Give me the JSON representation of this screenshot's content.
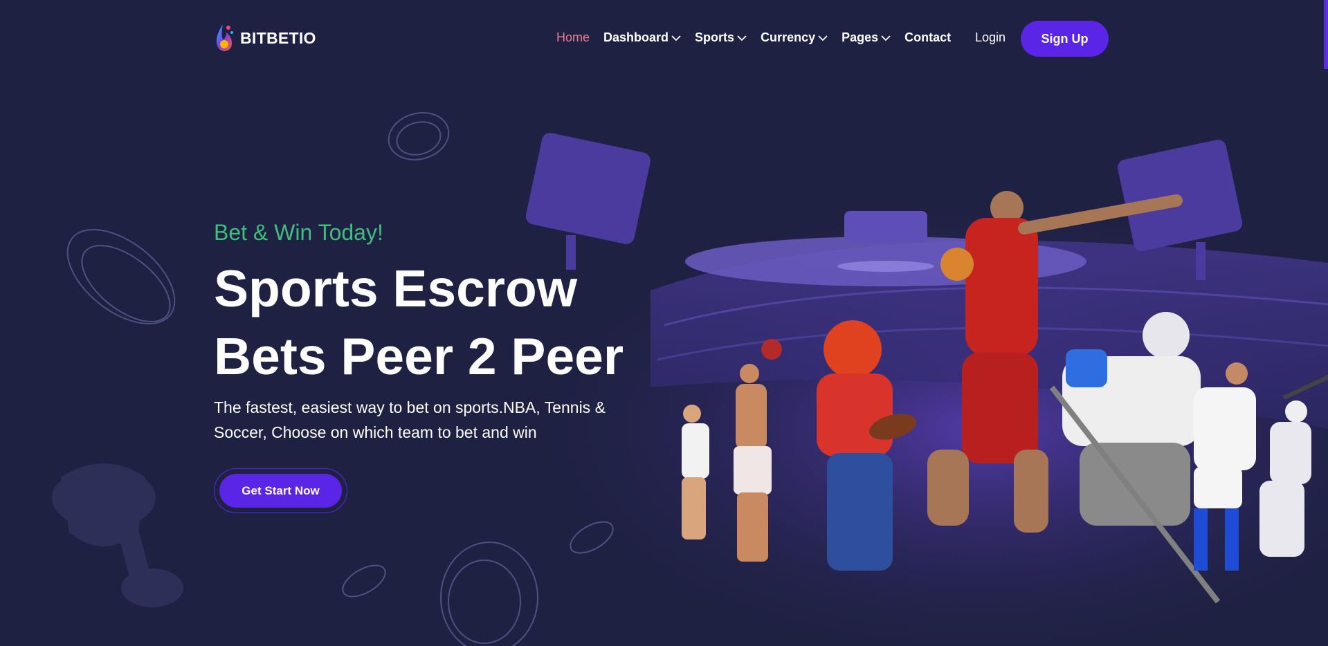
{
  "brand": {
    "name": "BITBETIO",
    "logo_icon": "flame-droplet-icon"
  },
  "nav": {
    "items": [
      {
        "label": "Home",
        "active": true,
        "dropdown": false
      },
      {
        "label": "Dashboard",
        "active": false,
        "dropdown": true
      },
      {
        "label": "Sports",
        "active": false,
        "dropdown": true
      },
      {
        "label": "Currency",
        "active": false,
        "dropdown": true
      },
      {
        "label": "Pages",
        "active": false,
        "dropdown": true
      },
      {
        "label": "Contact",
        "active": false,
        "dropdown": false
      }
    ],
    "login_label": "Login",
    "signup_label": "Sign Up"
  },
  "hero": {
    "tagline": "Bet & Win Today!",
    "headline": "Sports Escrow Bets Peer 2 Peer",
    "description": "The fastest, easiest way to bet on sports.NBA, Tennis & Soccer, Choose on which team to bet and win",
    "cta_label": "Get Start Now"
  },
  "colors": {
    "background": "#1f2143",
    "accent": "#5a25e6",
    "active_nav": "#ef7a8e",
    "tagline": "#3fbf7b"
  }
}
